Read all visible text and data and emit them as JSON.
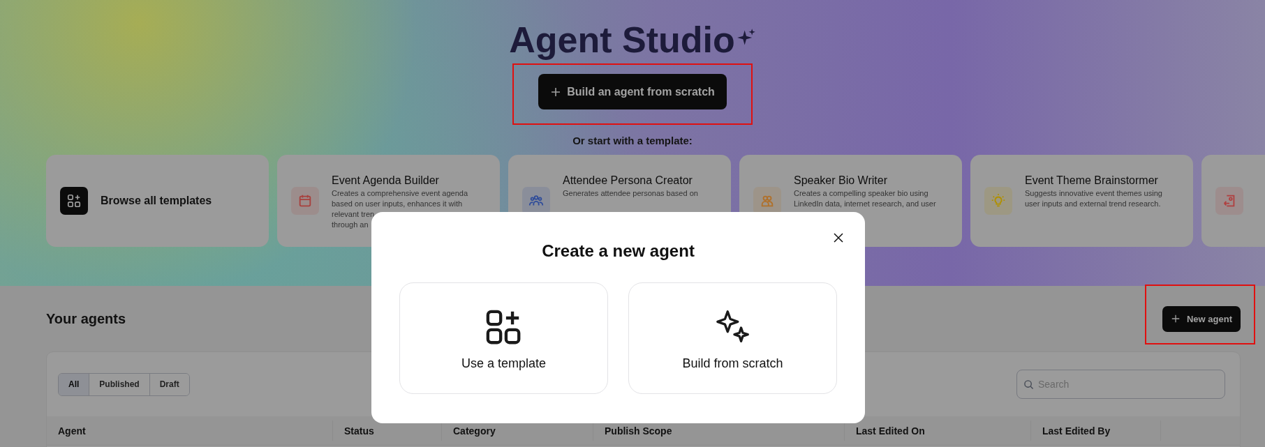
{
  "header": {
    "title": "Agent Studio",
    "build_button": {
      "label": "Build an agent from scratch",
      "highlighted": true
    },
    "template_prompt": "Or start with a template:"
  },
  "templates": [
    {
      "kind": "browse",
      "title": "Browse all templates"
    },
    {
      "kind": "template",
      "color": "#a8403d",
      "title": "Event Agenda Builder",
      "description_lines": [
        "Creates a comprehensive event agenda",
        "based on user inputs, enhances it with",
        "relevant tren",
        "through an"
      ]
    },
    {
      "kind": "template",
      "color": "#2f4c9a",
      "title": "Attendee Persona Creator",
      "description_lines": [
        "Generates attendee personas based on"
      ]
    },
    {
      "kind": "template",
      "color": "#b0702a",
      "title": "Speaker Bio Writer",
      "description_lines": [
        "Creates a compelling speaker bio using",
        "LinkedIn data, internet research, and user"
      ]
    },
    {
      "kind": "template",
      "color": "#b09000",
      "title": "Event Theme Brainstormer",
      "description_lines": [
        "Suggests innovative event themes using",
        "user inputs and external trend research."
      ]
    },
    {
      "kind": "template",
      "color": "#b04040"
    }
  ],
  "agents_section": {
    "title": "Your agents",
    "new_button": {
      "label": "New agent",
      "highlighted": true
    },
    "filters": [
      {
        "label": "All",
        "selected": true
      },
      {
        "label": "Published",
        "selected": false
      },
      {
        "label": "Draft",
        "selected": false
      }
    ],
    "search": {
      "placeholder": "Search"
    },
    "columns": [
      "Agent",
      "Status",
      "Category",
      "Publish Scope",
      "Last Edited On",
      "Last Edited By"
    ]
  },
  "modal": {
    "title": "Create a new agent",
    "options": [
      {
        "label": "Use a template"
      },
      {
        "label": "Build from scratch"
      }
    ]
  }
}
